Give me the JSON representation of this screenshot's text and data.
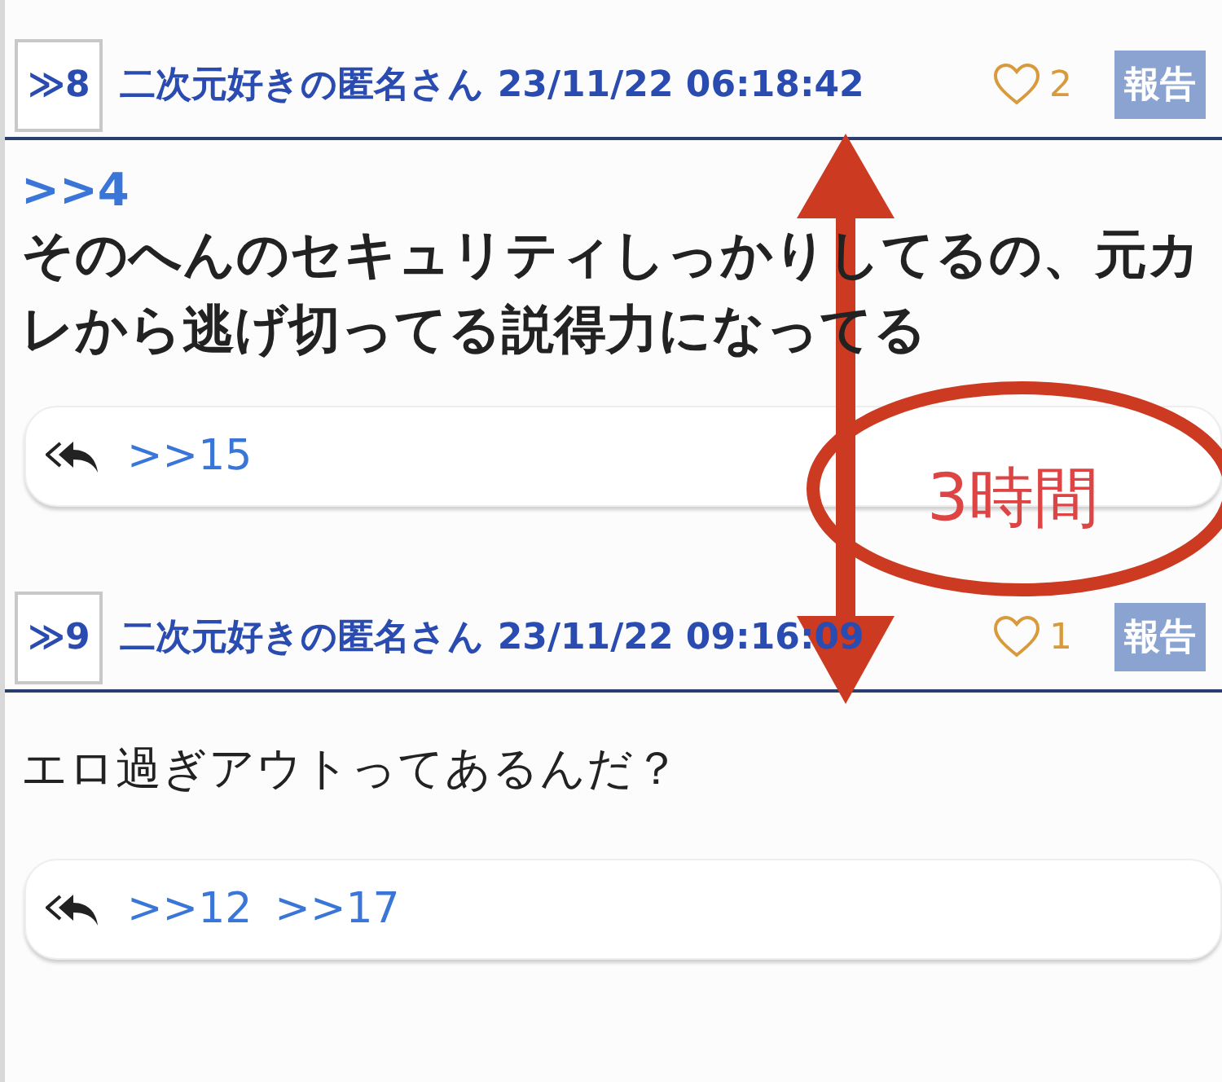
{
  "posts": [
    {
      "number": "≫8",
      "author": "二次元好きの匿名さん",
      "timestamp": "23/11/22 06:18:42",
      "likes": "2",
      "report": "報告",
      "quote": ">>4",
      "body": "そのへんのセキュリティしっかりしてるの、元カレから逃げ切ってる説得力になってる",
      "bold": true,
      "replies": [
        ">>15"
      ]
    },
    {
      "number": "≫9",
      "author": "二次元好きの匿名さん",
      "timestamp": "23/11/22 09:16:09",
      "likes": "1",
      "report": "報告",
      "body": "エロ過ぎアウトってあるんだ？",
      "bold": false,
      "replies": [
        ">>12",
        ">>17"
      ]
    }
  ],
  "annotation": {
    "label": "3時間"
  }
}
